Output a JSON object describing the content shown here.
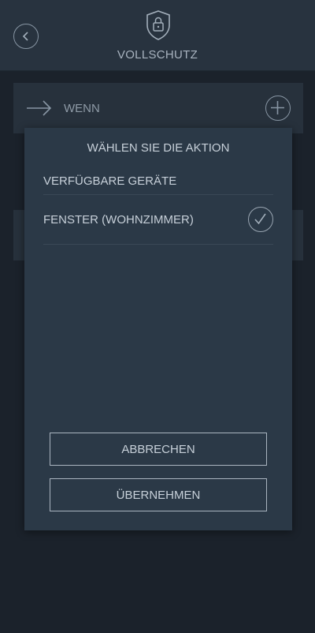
{
  "header": {
    "title": "VOLLSCHUTZ",
    "back_icon": "chevron-left-icon",
    "logo_icon": "shield-lock-icon"
  },
  "rule": {
    "wenn_label": "WENN",
    "arrow_icon": "arrow-right-icon",
    "add_icon": "plus-icon"
  },
  "dialog": {
    "title": "WÄHLEN SIE DIE AKTION",
    "section_label": "VERFÜGBARE GERÄTE",
    "devices": [
      {
        "label": "FENSTER (WOHNZIMMER)",
        "selected": true
      }
    ],
    "cancel_label": "ABBRECHEN",
    "apply_label": "ÜBERNEHMEN"
  },
  "colors": {
    "background": "#1b222b",
    "header": "#28333f",
    "dialog": "#2b3947",
    "text": "#c7d0d9"
  }
}
